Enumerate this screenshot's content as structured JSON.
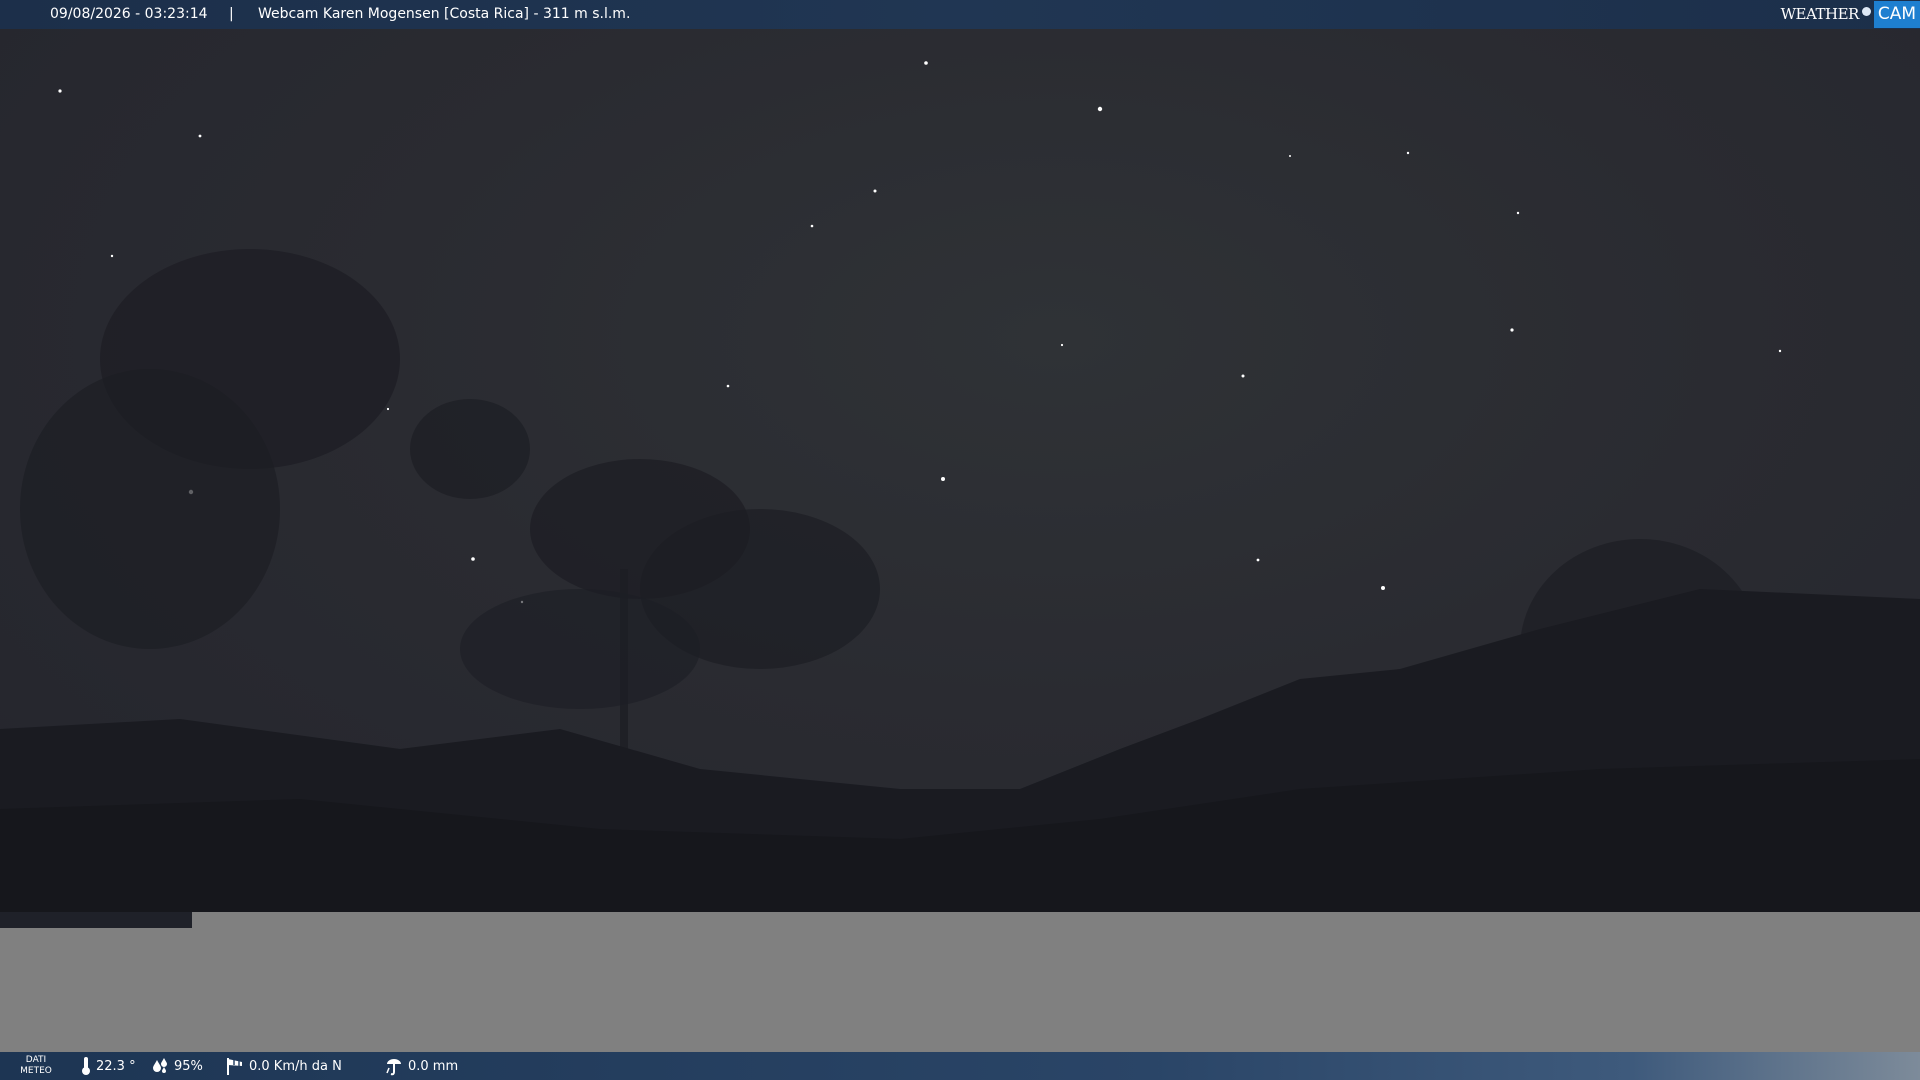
{
  "header": {
    "datetime": "09/08/2026 - 03:23:14",
    "separator": "|",
    "title": "Webcam Karen Mogensen [Costa Rica]  - 311 m s.l.m."
  },
  "logo": {
    "weather_text": "WEATHER",
    "cam_text": "CAM"
  },
  "weather_bar": {
    "label_line1": "DATI",
    "label_line2": "METEO",
    "temperature": "22.3 °",
    "humidity": "95%",
    "wind": "0.0 Km/h da N",
    "rain": "0.0 mm"
  },
  "icons": {
    "temperature": "thermometer-icon",
    "humidity": "humidity-drops-icon",
    "wind": "wind-sock-icon",
    "rain": "rain-gauge-icon"
  },
  "colors": {
    "top_bar": "#1c2f4a",
    "logo_accent": "#1e7fd0",
    "sky": "#2a2b31",
    "gray_panel": "#808080"
  }
}
